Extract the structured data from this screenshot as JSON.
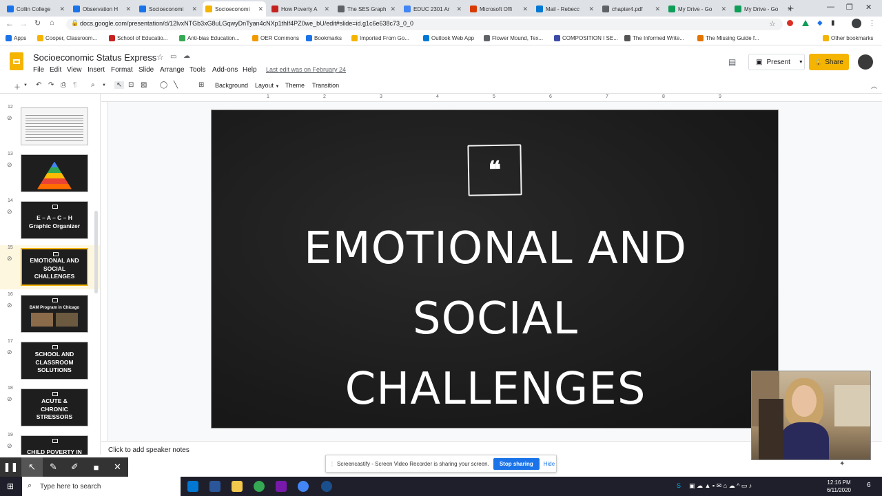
{
  "browser": {
    "tabs": [
      {
        "label": "Collin College",
        "color": "#1a73e8"
      },
      {
        "label": "Observation H",
        "color": "#1a73e8"
      },
      {
        "label": "Socioeconomi",
        "color": "#1a73e8"
      },
      {
        "label": "Socioeconomi",
        "color": "#f4b400",
        "active": true
      },
      {
        "label": "How Poverty A",
        "color": "#c5221f"
      },
      {
        "label": "The SES Graph",
        "color": "#5f6368"
      },
      {
        "label": "EDUC 2301 Ar",
        "color": "#4285f4"
      },
      {
        "label": "Microsoft Offi",
        "color": "#d83b01"
      },
      {
        "label": "Mail - Rebecc",
        "color": "#0078d4"
      },
      {
        "label": "chapter4.pdf",
        "color": "#5f6368"
      },
      {
        "label": "My Drive - Go",
        "color": "#0f9d58"
      },
      {
        "label": "My Drive - Go",
        "color": "#0f9d58"
      }
    ],
    "url": "docs.google.com/presentation/d/12lvxNTGb3xG8uLGqwyDnTyan4cNXp1thIf4PZ0we_bU/edit#slide=id.g1c6e638c73_0_0",
    "bookmarks": [
      "Apps",
      "Cooper, Classroom...",
      "School of Educatio...",
      "Anti-bias Education...",
      "OER Commons",
      "Bookmarks",
      "Imported From Go...",
      "Outlook Web App",
      "Flower Mound, Tex...",
      "COMPOSITION I SE...",
      "The Informed Write...",
      "The Missing Guide f..."
    ],
    "other_bookmarks": "Other bookmarks"
  },
  "slides": {
    "doc_title": "Socioeconomic Status Express",
    "menus": [
      "File",
      "Edit",
      "View",
      "Insert",
      "Format",
      "Slide",
      "Arrange",
      "Tools",
      "Add-ons",
      "Help"
    ],
    "last_edit": "Last edit was on February 24",
    "present_label": "Present",
    "share_label": "Share",
    "toolbar": {
      "background": "Background",
      "layout": "Layout",
      "theme": "Theme",
      "transition": "Transition"
    },
    "ruler_marks": [
      "1",
      "2",
      "3",
      "4",
      "5",
      "6",
      "7",
      "8",
      "9"
    ],
    "filmstrip": [
      {
        "num": "12",
        "kind": "text",
        "title": ""
      },
      {
        "num": "13",
        "kind": "pyramid",
        "title": ""
      },
      {
        "num": "14",
        "kind": "title",
        "title": "E – A – C – H\nGraphic Organizer"
      },
      {
        "num": "15",
        "kind": "title",
        "title": "EMOTIONAL AND\nSOCIAL\nCHALLENGES",
        "selected": true
      },
      {
        "num": "16",
        "kind": "photo",
        "title": "BAM Program in Chicago"
      },
      {
        "num": "17",
        "kind": "title",
        "title": "SCHOOL AND\nCLASSROOM\nSOLUTIONS"
      },
      {
        "num": "18",
        "kind": "title",
        "title": "ACUTE &\nCHRONIC\nSTRESSORS"
      },
      {
        "num": "19",
        "kind": "title",
        "title": "CHILD POVERTY IN THE US"
      }
    ],
    "current_slide": {
      "quote_mark": "❝",
      "title_lines": [
        "EMOTIONAL AND",
        "SOCIAL",
        "CHALLENGES"
      ]
    },
    "speaker_notes_placeholder": "Click to add speaker notes"
  },
  "screencastify": {
    "message": "Screencastify - Screen Video Recorder is sharing your screen.",
    "stop_label": "Stop sharing",
    "hide_label": "Hide"
  },
  "taskbar": {
    "search_placeholder": "Type here to search",
    "time": "12:16 PM",
    "date": "6/11/2020",
    "notification_count": "6"
  }
}
